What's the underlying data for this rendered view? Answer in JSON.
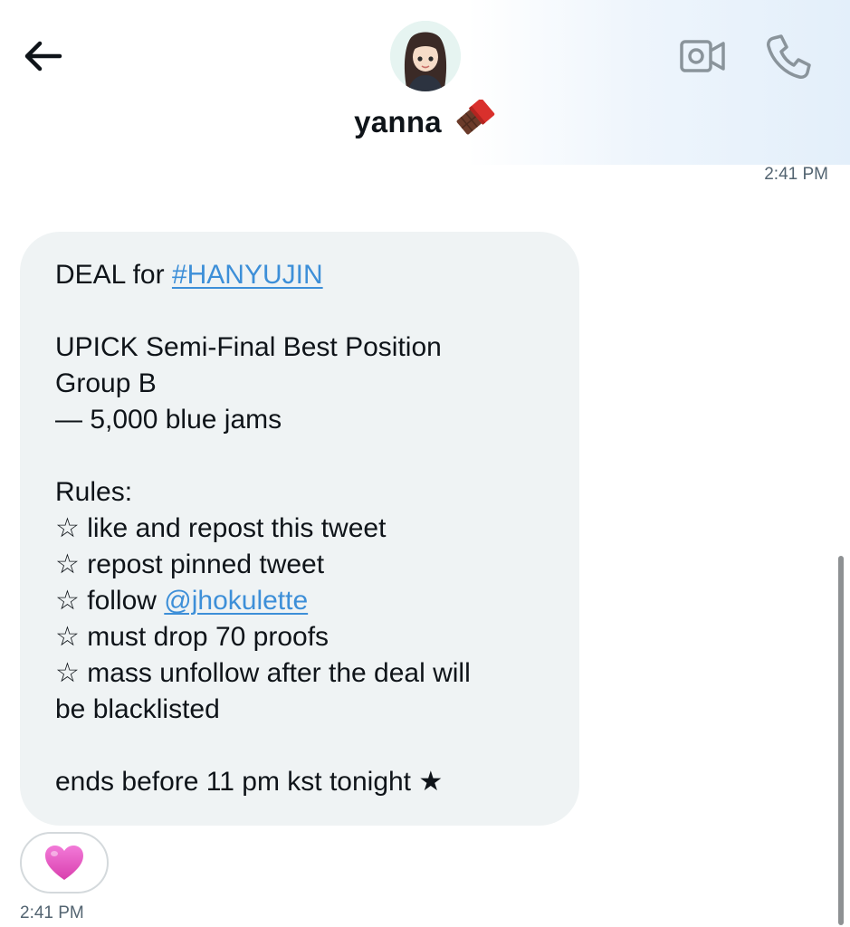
{
  "header": {
    "contact_name": "yanna",
    "name_emoji": "chocolate-bar-icon",
    "icons": {
      "back": "arrow-left-icon",
      "video": "video-camera-icon",
      "call": "phone-icon"
    }
  },
  "timestamps": {
    "top": "2:41 PM",
    "bottom": "2:41 PM"
  },
  "message": {
    "line_1_text": "DEAL for ",
    "line_1_hashtag": "#HANYUJIN",
    "line_2": "UPICK Semi-Final Best Position",
    "line_3": "Group B",
    "line_4": "— 5,000 blue jams",
    "rules_heading": "Rules:",
    "rule_1": "☆ like and repost this tweet",
    "rule_2": "☆ repost pinned tweet",
    "rule_3_text": "☆ follow ",
    "rule_3_mention": "@jhokulette",
    "rule_4": "☆ must drop 70 proofs",
    "rule_5a": "☆ mass unfollow after the deal will",
    "rule_5b": "be blacklisted",
    "closing": "ends before 11 pm kst tonight ★"
  },
  "reaction": {
    "icon": "pink-heart-icon"
  },
  "colors": {
    "link": "#3d8fd8",
    "bubble": "#eff3f4",
    "muted_text": "#536471",
    "heart": "#e85bc9"
  }
}
